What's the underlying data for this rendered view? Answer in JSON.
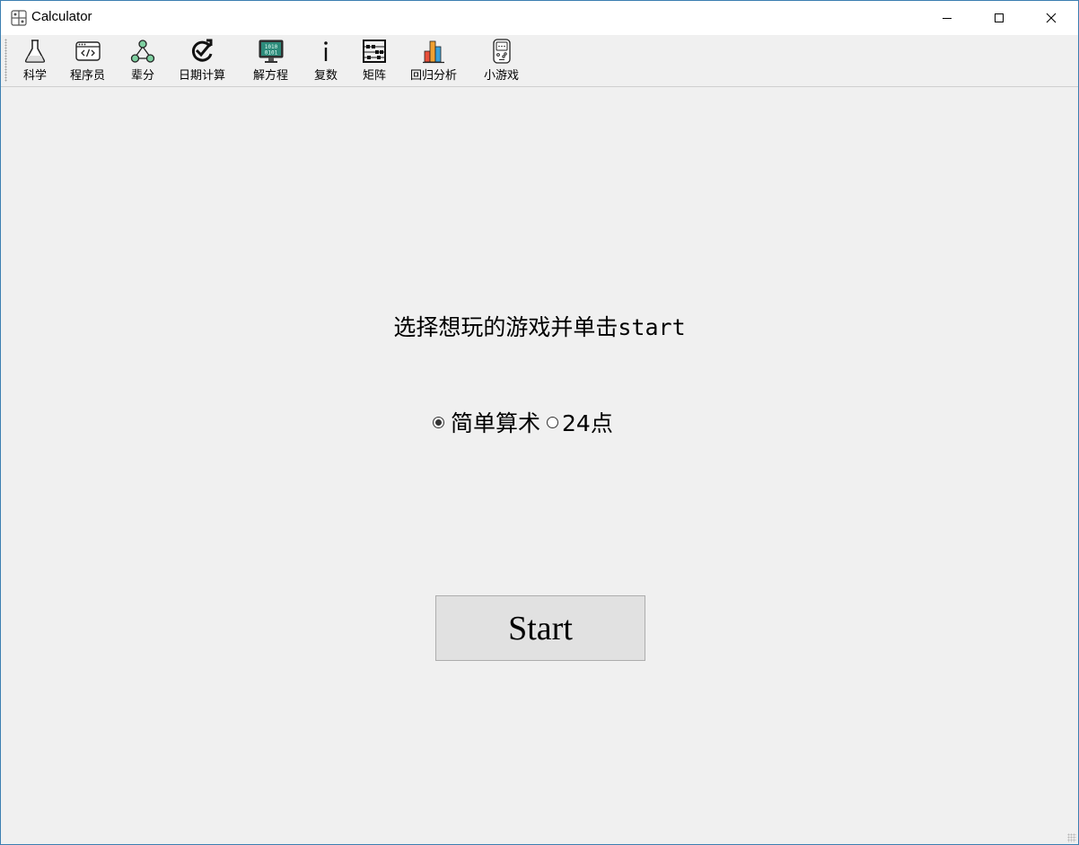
{
  "window": {
    "title": "Calculator",
    "controls": [
      "minimize-icon",
      "maximize-icon",
      "close-icon"
    ],
    "accent_border": "#3c7fb1"
  },
  "toolbar": {
    "items": [
      {
        "label": "科学",
        "icon": "flask-icon"
      },
      {
        "label": "程序员",
        "icon": "code-window-icon"
      },
      {
        "label": "辈分",
        "icon": "family-tree-icon"
      },
      {
        "label": "日期计算",
        "icon": "check-refresh-icon"
      },
      {
        "label": "解方程",
        "icon": "binary-monitor-icon"
      },
      {
        "label": "复数",
        "icon": "info-i-icon"
      },
      {
        "label": "矩阵",
        "icon": "abacus-icon"
      },
      {
        "label": "回归分析",
        "icon": "bar-chart-icon"
      },
      {
        "label": "小游戏",
        "icon": "game-device-icon"
      }
    ]
  },
  "main": {
    "prompt": "选择想玩的游戏并单击start",
    "options": [
      {
        "label": "简单算术",
        "checked": true
      },
      {
        "label": "24点",
        "checked": false
      }
    ],
    "start_label": "Start"
  }
}
